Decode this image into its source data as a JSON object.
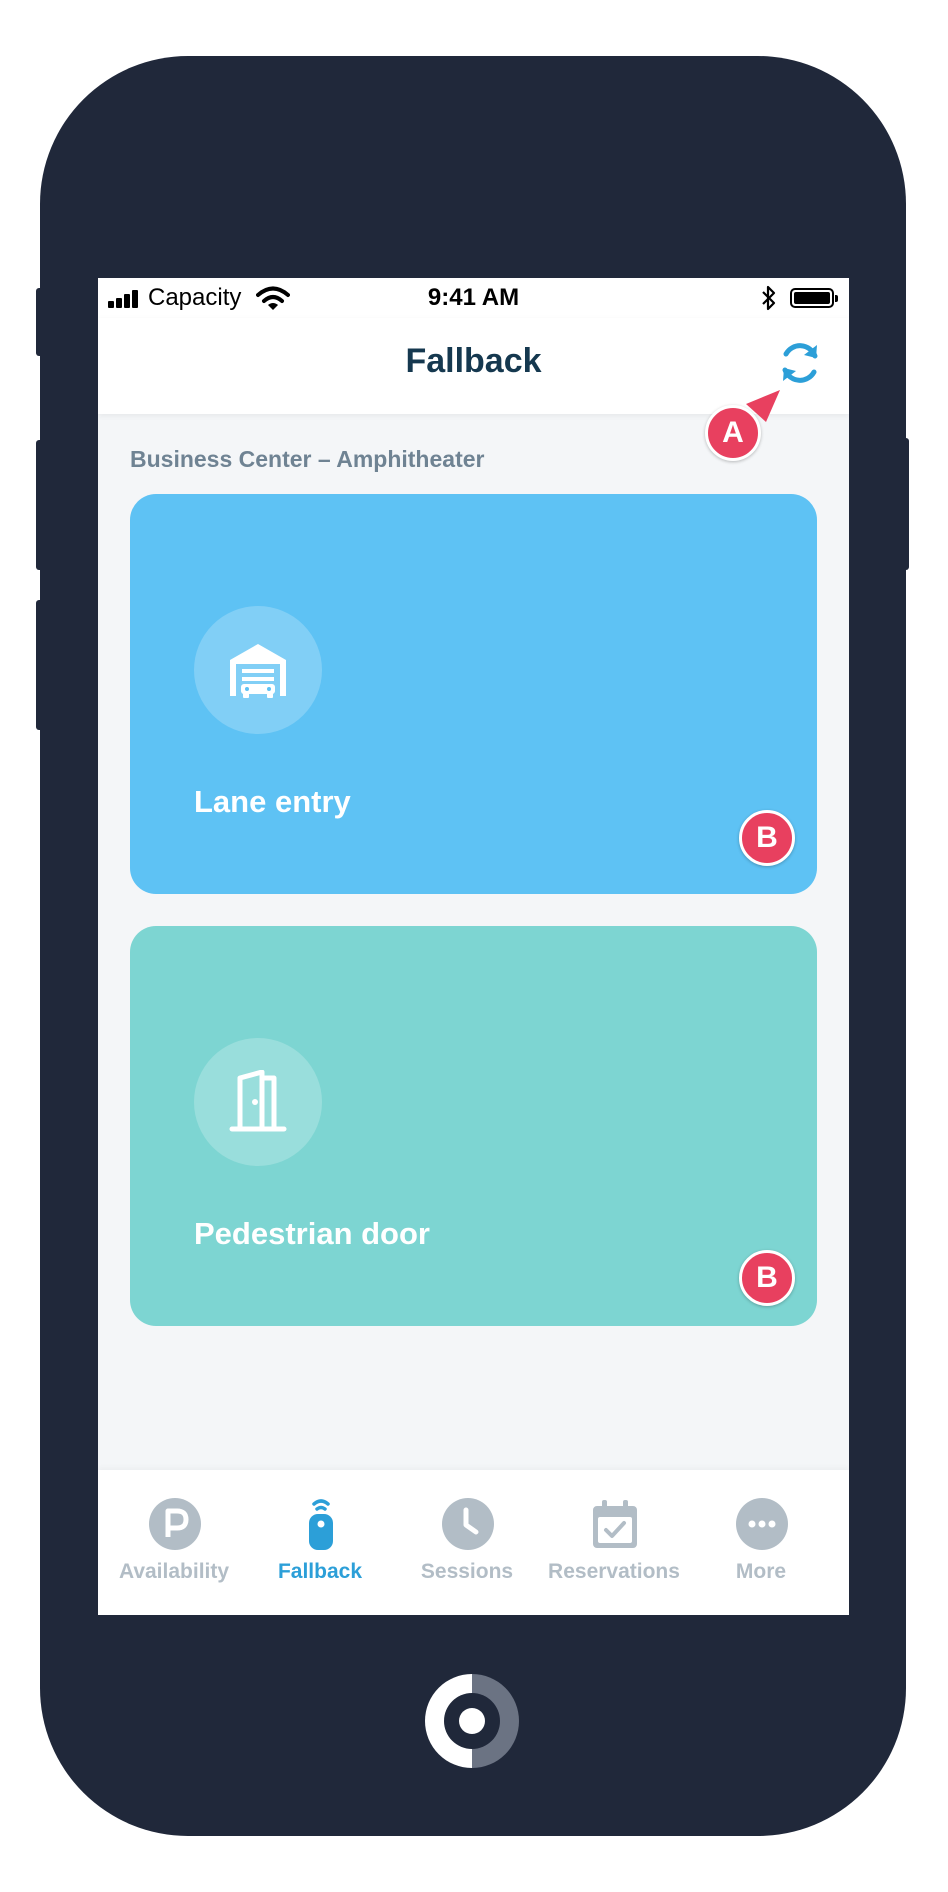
{
  "status_bar": {
    "carrier": "Capacity",
    "time": "9:41 AM"
  },
  "header": {
    "title": "Fallback",
    "refresh_icon": "refresh-icon"
  },
  "section": {
    "title": "Business Center – Amphitheater"
  },
  "cards": [
    {
      "label": "Lane entry",
      "icon": "garage-car-icon",
      "color": "#5ec2f4"
    },
    {
      "label": "Pedestrian door",
      "icon": "door-icon",
      "color": "#7dd5d2"
    }
  ],
  "tabs": [
    {
      "label": "Availability",
      "icon": "parking-icon",
      "active": false
    },
    {
      "label": "Fallback",
      "icon": "remote-icon",
      "active": true
    },
    {
      "label": "Sessions",
      "icon": "clock-icon",
      "active": false
    },
    {
      "label": "Reservations",
      "icon": "calendar-check-icon",
      "active": false
    },
    {
      "label": "More",
      "icon": "more-icon",
      "active": false
    }
  ],
  "annotations": {
    "a": "A",
    "b": "B"
  },
  "colors": {
    "accent": "#2c9fd8",
    "marker": "#e8405f",
    "device": "#20283a",
    "title": "#15384f"
  }
}
